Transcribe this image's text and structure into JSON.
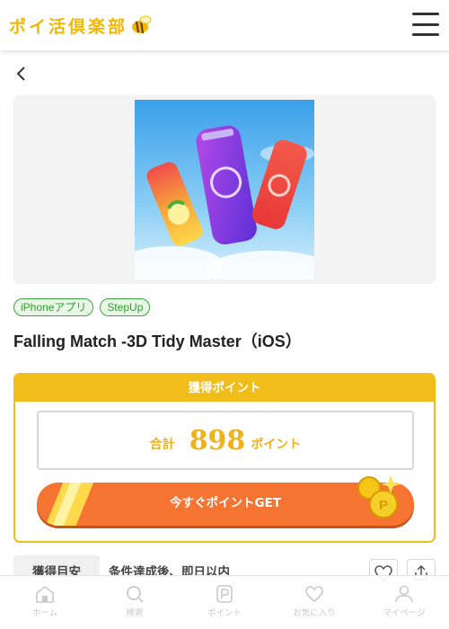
{
  "header": {
    "logo_text": "ポイ活倶楽部",
    "logo_color": "#f2b705"
  },
  "tags": [
    "iPhoneアプリ",
    "StepUp"
  ],
  "offer": {
    "title": "Falling Match -3D Tidy Master（iOS）"
  },
  "points": {
    "heading": "獲得ポイント",
    "total_label": "合計",
    "total_value": "898",
    "total_unit": "ポイント",
    "cta_label": "今すぐポイントGET"
  },
  "estimate": {
    "label": "獲得目安",
    "value": "条件達成後、即日以内"
  },
  "tabbar": {
    "items": [
      {
        "label": "ホーム",
        "icon": "home-icon"
      },
      {
        "label": "検索",
        "icon": "search-icon"
      },
      {
        "label": "ポイント",
        "icon": "points-icon"
      },
      {
        "label": "お気に入り",
        "icon": "heart-icon"
      },
      {
        "label": "マイページ",
        "icon": "user-icon"
      }
    ]
  },
  "colors": {
    "accent_yellow": "#f0bd1b",
    "cta_orange": "#f57431",
    "tag_green": "#3aa63a",
    "tab_inactive": "#c9c9c9"
  }
}
